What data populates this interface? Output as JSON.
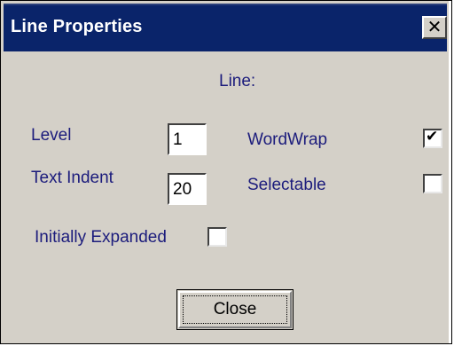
{
  "window": {
    "title": "Line Properties",
    "close_glyph": "✕"
  },
  "section": {
    "heading": "Line:"
  },
  "fields": {
    "level": {
      "label": "Level",
      "value": "1"
    },
    "text_indent": {
      "label": "Text Indent",
      "value": "20"
    }
  },
  "options": {
    "wordwrap": {
      "label": "WordWrap",
      "checked": true,
      "mark": "✔"
    },
    "selectable": {
      "label": "Selectable",
      "checked": false
    },
    "initially_expanded": {
      "label": "Initially Expanded",
      "checked": false
    }
  },
  "buttons": {
    "close_label": "Close"
  },
  "colors": {
    "titlebar": "#0a246a",
    "face": "#d4d0c8",
    "label_text": "#1c1c7c"
  }
}
